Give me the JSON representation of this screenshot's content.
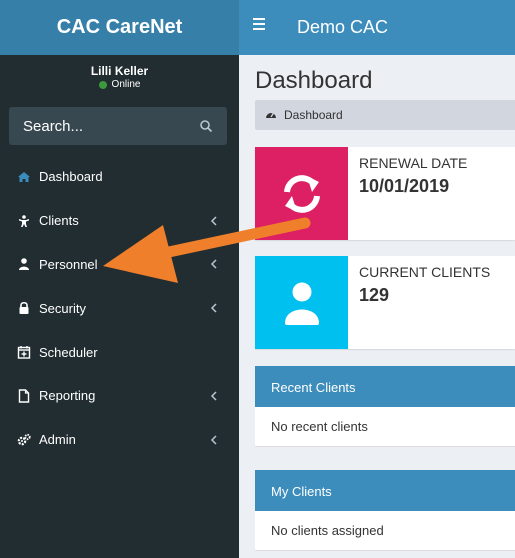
{
  "brand": {
    "title": "CAC CareNet"
  },
  "user": {
    "name": "Lilli Keller",
    "status": "Online"
  },
  "search": {
    "placeholder": "Search..."
  },
  "menu": [
    {
      "label": "Dashboard",
      "icon": "dashboard-icon"
    },
    {
      "label": "Clients",
      "icon": "child-icon"
    },
    {
      "label": "Personnel",
      "icon": "user-icon"
    },
    {
      "label": "Security",
      "icon": "lock-icon"
    },
    {
      "label": "Scheduler",
      "icon": "calendar-plus-icon"
    },
    {
      "label": "Reporting",
      "icon": "file-icon"
    },
    {
      "label": "Admin",
      "icon": "gears-icon"
    }
  ],
  "topbar": {
    "title": "Demo CAC"
  },
  "page": {
    "title": "Dashboard",
    "breadcrumb": "Dashboard"
  },
  "info_boxes": [
    {
      "label": "RENEWAL DATE",
      "value": "10/01/2019",
      "color": "#dd1f63",
      "icon": "refresh-icon"
    },
    {
      "label": "CURRENT CLIENTS",
      "value": "129",
      "color": "#00c0ef",
      "icon": "user-icon"
    }
  ],
  "panels": [
    {
      "title": "Recent Clients",
      "body": "No recent clients"
    },
    {
      "title": "My Clients",
      "body": "No clients assigned"
    }
  ],
  "colors": {
    "sidebar": "#222d32",
    "brand": "#367fa9",
    "topbar": "#3c8dbc",
    "annotation_arrow": "#f07f2c"
  }
}
